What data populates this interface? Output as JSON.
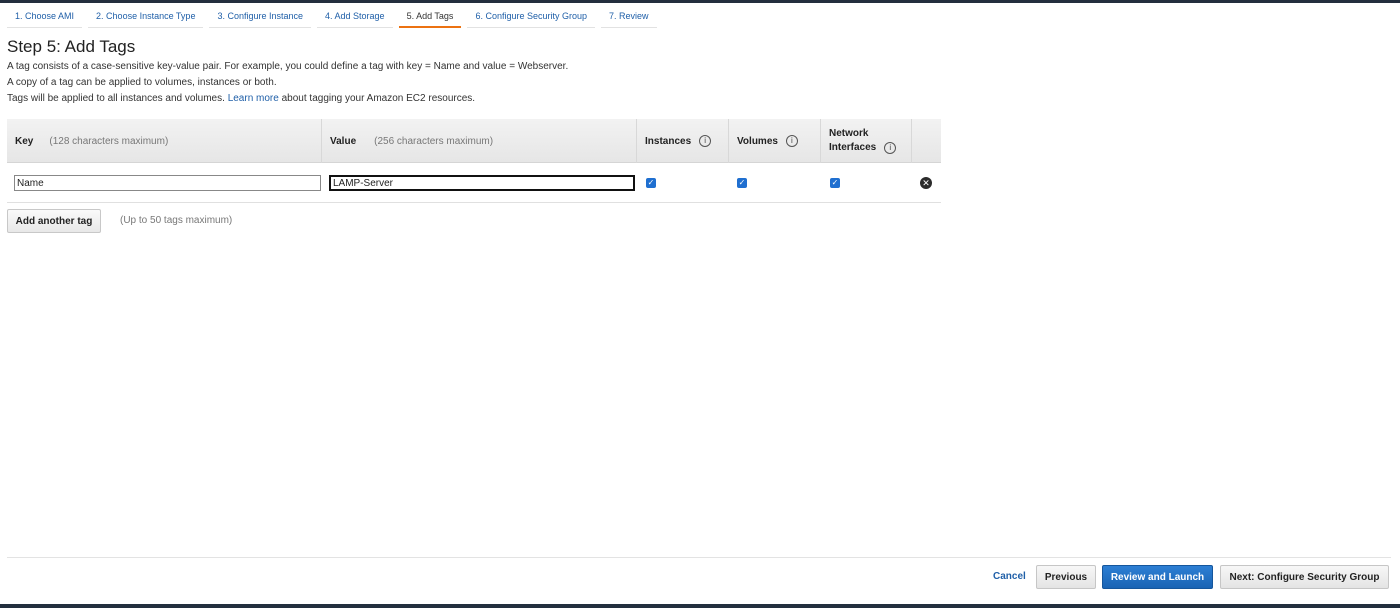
{
  "wizard": {
    "tabs": [
      {
        "label": "1. Choose AMI"
      },
      {
        "label": "2. Choose Instance Type"
      },
      {
        "label": "3. Configure Instance"
      },
      {
        "label": "4. Add Storage"
      },
      {
        "label": "5. Add Tags",
        "active": true
      },
      {
        "label": "6. Configure Security Group"
      },
      {
        "label": "7. Review"
      }
    ]
  },
  "page": {
    "title": "Step 5: Add Tags",
    "desc1": "A tag consists of a case-sensitive key-value pair. For example, you could define a tag with key = Name and value = Webserver.",
    "desc2": "A copy of a tag can be applied to volumes, instances or both.",
    "desc3_pre": "Tags will be applied to all instances and volumes.",
    "desc3_link": "Learn more",
    "desc3_post": "about tagging your Amazon EC2 resources."
  },
  "table": {
    "headers": {
      "key": "Key",
      "key_hint": "(128 characters maximum)",
      "value": "Value",
      "value_hint": "(256 characters maximum)",
      "instances": "Instances",
      "volumes": "Volumes",
      "network_line1": "Network",
      "network_line2": "Interfaces",
      "info_glyph": "i"
    },
    "rows": [
      {
        "key": "Name",
        "value": "LAMP-Server",
        "instances": true,
        "volumes": true,
        "network_interfaces": true
      }
    ],
    "check_glyph": "✓",
    "remove_glyph": "✕"
  },
  "actions": {
    "add_tag": "Add another tag",
    "add_hint": "(Up to 50 tags maximum)",
    "cancel": "Cancel",
    "previous": "Previous",
    "review_launch": "Review and Launch",
    "next": "Next: Configure Security Group"
  },
  "colors": {
    "accent": "#ec7211",
    "link": "#1f5fa8",
    "primary_button": "#1a64b4",
    "checkbox": "#1f6fd0"
  }
}
